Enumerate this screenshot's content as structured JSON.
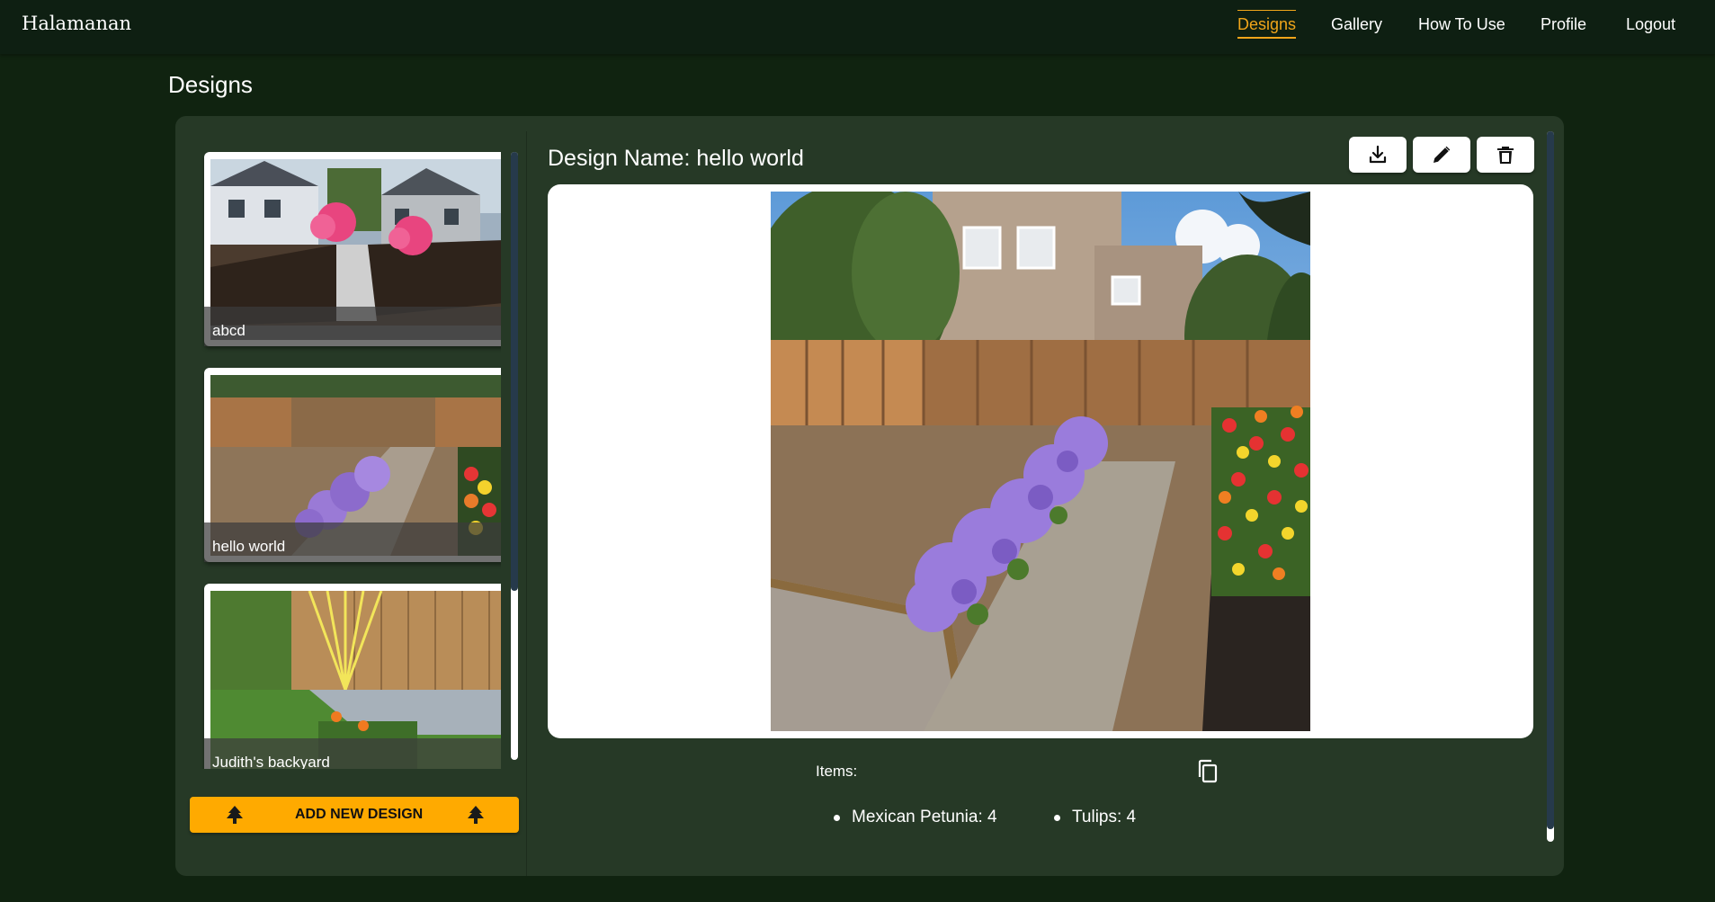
{
  "app": {
    "brand": "Halamanan"
  },
  "nav": [
    {
      "label": "Designs",
      "active": true
    },
    {
      "label": "Gallery",
      "active": false
    },
    {
      "label": "How To Use",
      "active": false
    },
    {
      "label": "Profile",
      "active": false
    },
    {
      "label": "Logout",
      "active": false
    }
  ],
  "page": {
    "title": "Designs"
  },
  "designs": [
    {
      "name": "abcd",
      "thumbnail": "front-yard-flower-beds"
    },
    {
      "name": "hello world",
      "thumbnail": "backyard-petunia-tulips"
    },
    {
      "name": "Judith's backyard",
      "thumbnail": "backyard-bamboo-grass"
    }
  ],
  "add_button": {
    "label": "ADD NEW DESIGN",
    "icon": "tree-icon"
  },
  "detail": {
    "design_name": "Design Name: hello world",
    "actions": [
      {
        "name": "download",
        "icon": "download-icon"
      },
      {
        "name": "edit",
        "icon": "pencil-icon"
      },
      {
        "name": "delete",
        "icon": "trash-icon"
      }
    ],
    "items_label": "Items:",
    "items": [
      "Mexican Petunia: 4",
      "Tulips: 4"
    ]
  },
  "colors": {
    "background": "#102310",
    "topbar": "#0e1f12",
    "panel": "#263926",
    "accent": "#f0a51a",
    "add_button": "#ffaa00"
  }
}
